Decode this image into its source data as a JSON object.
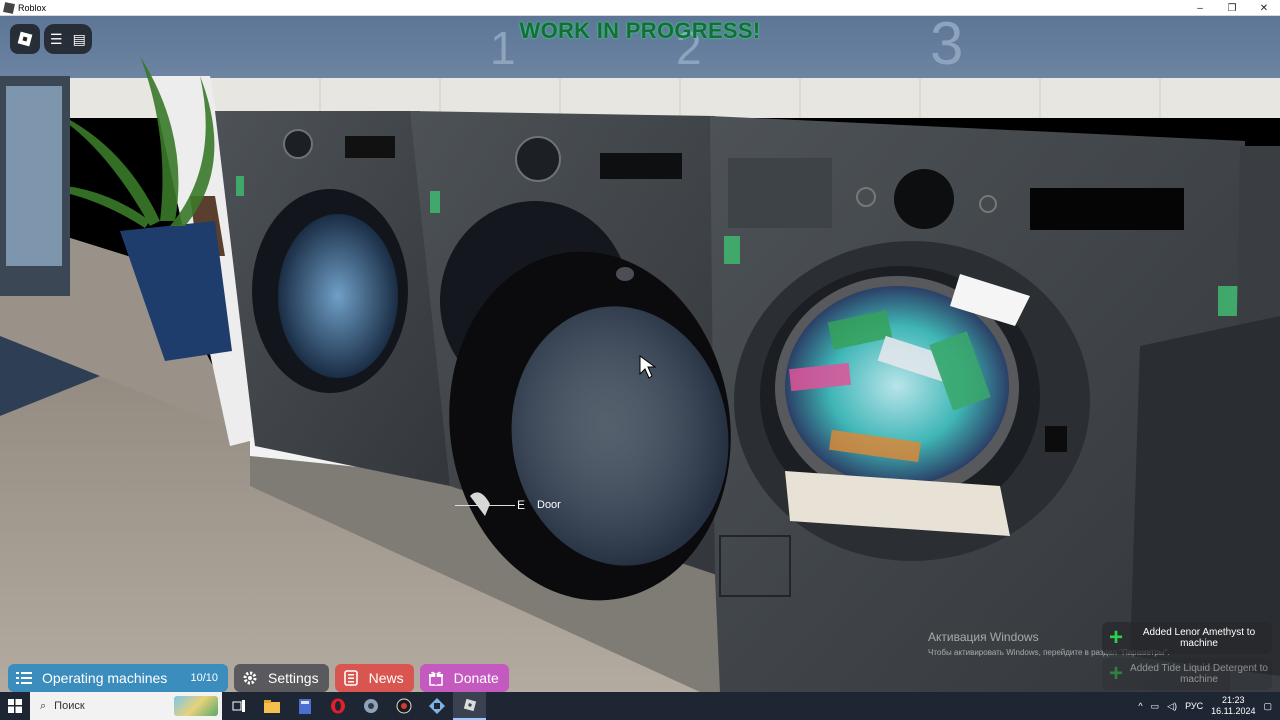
{
  "window": {
    "title": "Roblox",
    "controls": [
      "–",
      "❐",
      "✕"
    ]
  },
  "banner": {
    "text": "WORK IN PROGRESS!"
  },
  "topbar": {
    "icons": [
      "roblox-logo-icon",
      "menu-icon",
      "chat-icon"
    ]
  },
  "prompt": {
    "key": "E",
    "label": "Door"
  },
  "activation": {
    "title": "Активация Windows",
    "subtitle": "Чтобы активировать Windows, перейдите в раздел \"Параметры\"."
  },
  "notifications": [
    {
      "text": "Added Lenor Amethyst to machine"
    },
    {
      "text": "Added Tide Liquid Detergent to machine"
    }
  ],
  "game_buttons": {
    "machines": {
      "label": "Operating machines",
      "count": "10/10",
      "icon": "list-icon",
      "color": "#3b8dbd"
    },
    "settings": {
      "label": "Settings",
      "icon": "gear-icon",
      "color": "#5a5a5e"
    },
    "news": {
      "label": "News",
      "icon": "news-icon",
      "color": "#d95650"
    },
    "donate": {
      "label": "Donate",
      "icon": "gift-icon",
      "color": "#c45abf"
    }
  },
  "taskbar": {
    "search_placeholder": "Поиск",
    "apps": [
      "task-view-icon",
      "file-explorer-icon",
      "calculator-icon",
      "opera-icon",
      "app-icon",
      "obs-icon",
      "app2-icon",
      "roblox-icon"
    ],
    "language": "РУС",
    "time": "21:23",
    "date": "16.11.2024"
  }
}
